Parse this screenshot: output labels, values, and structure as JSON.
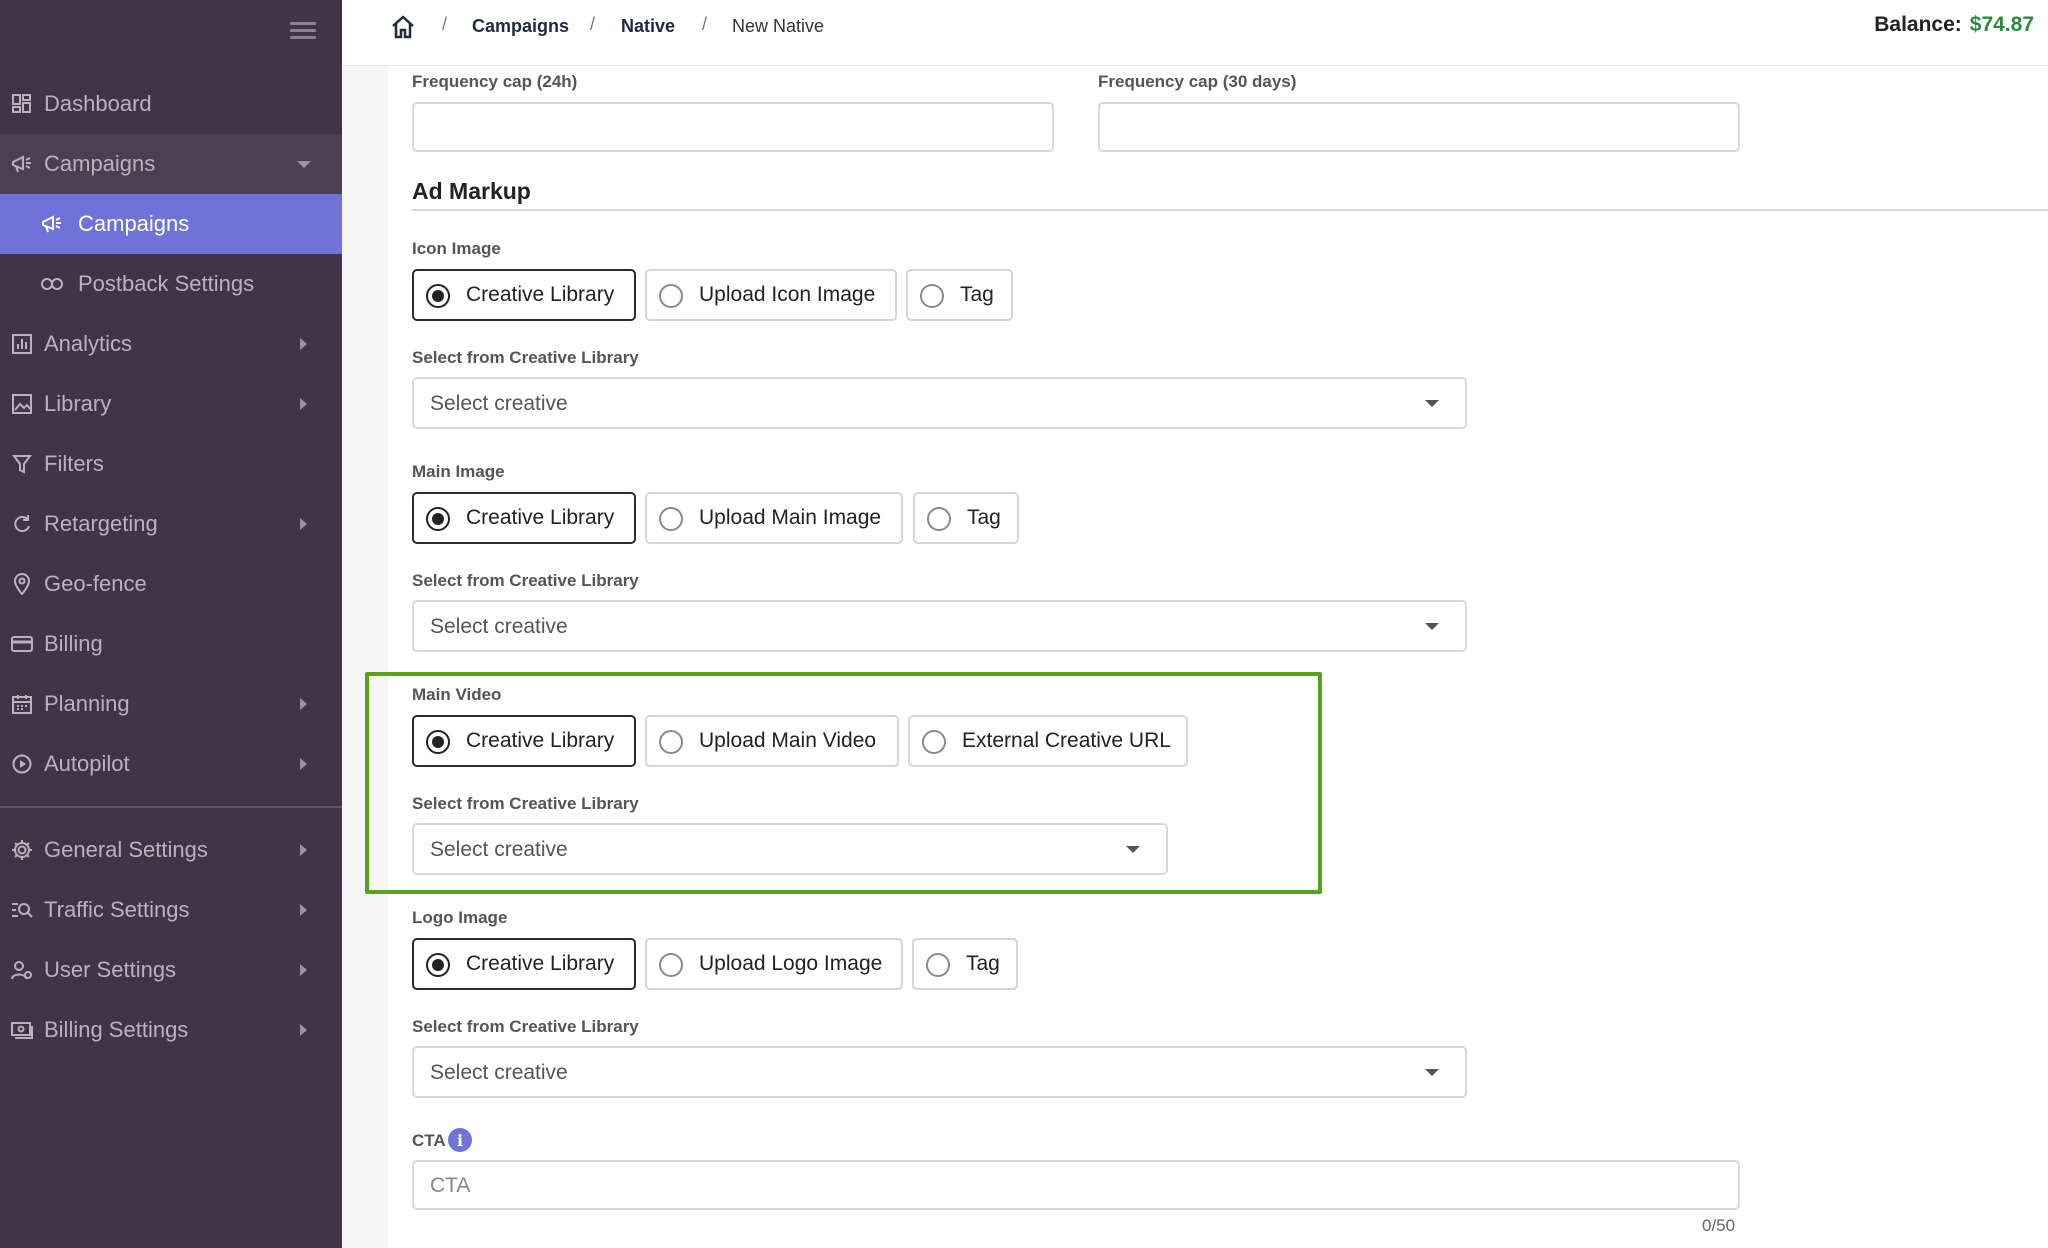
{
  "breadcrumb": {
    "items": [
      "Campaigns",
      "Native"
    ],
    "current": "New Native",
    "separator": "/"
  },
  "balance": {
    "label": "Balance:",
    "amount": "$74.87"
  },
  "sidebar": {
    "items": [
      {
        "label": "Dashboard",
        "icon": "dashboard-icon"
      },
      {
        "label": "Campaigns",
        "icon": "megaphone-icon"
      },
      {
        "label": "Campaigns",
        "icon": "megaphone-icon"
      },
      {
        "label": "Postback Settings",
        "icon": "link-icon"
      },
      {
        "label": "Analytics",
        "icon": "chart-icon"
      },
      {
        "label": "Library",
        "icon": "image-icon"
      },
      {
        "label": "Filters",
        "icon": "filter-icon"
      },
      {
        "label": "Retargeting",
        "icon": "refresh-icon"
      },
      {
        "label": "Geo-fence",
        "icon": "map-pin-icon"
      },
      {
        "label": "Billing",
        "icon": "credit-card-icon"
      },
      {
        "label": "Planning",
        "icon": "calendar-icon"
      },
      {
        "label": "Autopilot",
        "icon": "play-circle-icon"
      },
      {
        "label": "General Settings",
        "icon": "gear-icon"
      },
      {
        "label": "Traffic Settings",
        "icon": "traffic-search-icon"
      },
      {
        "label": "User Settings",
        "icon": "user-gear-icon"
      },
      {
        "label": "Billing Settings",
        "icon": "money-icon"
      }
    ]
  },
  "form": {
    "freq_24h_label": "Frequency cap (24h)",
    "freq_30d_label": "Frequency cap (30 days)",
    "section_title": "Ad Markup",
    "select_from_library_label": "Select from Creative Library",
    "select_placeholder": "Select creative",
    "icon_image": {
      "label": "Icon Image",
      "options": [
        "Creative Library",
        "Upload Icon Image",
        "Tag"
      ],
      "selected": "Creative Library"
    },
    "main_image": {
      "label": "Main Image",
      "options": [
        "Creative Library",
        "Upload Main Image",
        "Tag"
      ],
      "selected": "Creative Library"
    },
    "main_video": {
      "label": "Main Video",
      "options": [
        "Creative Library",
        "Upload Main Video",
        "External Creative URL"
      ],
      "selected": "Creative Library"
    },
    "logo_image": {
      "label": "Logo Image",
      "options": [
        "Creative Library",
        "Upload Logo Image",
        "Tag"
      ],
      "selected": "Creative Library"
    },
    "cta": {
      "label": "CTA",
      "placeholder": "CTA",
      "counter": "0/50"
    }
  },
  "colors": {
    "sidebar_bg": "#3f3547",
    "active_item": "#6f73d8",
    "balance_amount": "#2b8a3e",
    "highlight_border": "#58a21f"
  }
}
